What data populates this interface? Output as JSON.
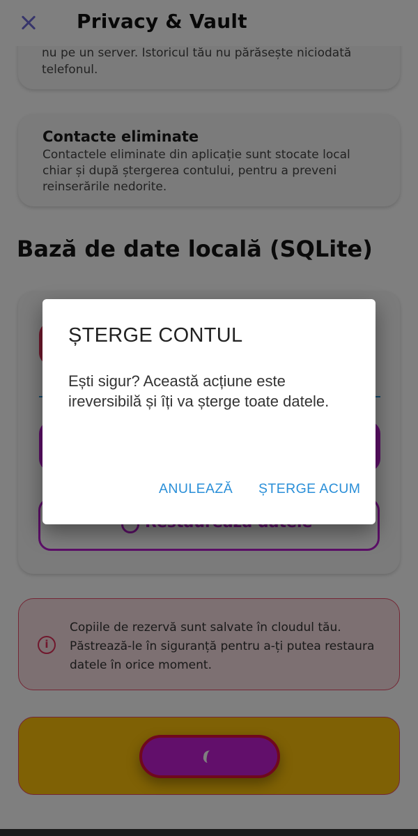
{
  "header": {
    "title": "Privacy & Vault",
    "close_icon": "close-icon"
  },
  "cards": {
    "history": {
      "text": "nu pe un server. Istoricul tău nu părăsește niciodată telefonul."
    },
    "deleted_contacts": {
      "title": "Contacte eliminate",
      "text": "Contactele eliminate din aplicație sunt stocate local chiar și după ștergerea contului, pentru a preveni reinserările nedorite."
    }
  },
  "sqlite_section": {
    "title": "Bază de date locală (SQLite)",
    "restore_label": "Restaurează datele",
    "restore_icon": "restore-icon"
  },
  "info": {
    "icon": "info-icon",
    "text": "Copiile de rezervă sunt salvate în cloudul tău. Păstrează-le în siguranță pentru a-ți putea restaura datele în orice moment."
  },
  "dialog": {
    "title": "ȘTERGE CONTUL",
    "body": "Ești sigur? Această acțiune este ireversibilă și îți va șterge toate datele.",
    "cancel_label": "ANULEAZĂ",
    "confirm_label": "ȘTERGE ACUM"
  },
  "colors": {
    "accent_blue": "#2a8fd8",
    "purple": "#b81fd0",
    "danger_red": "#e0305a",
    "warning_yellow": "#fec20a",
    "close_icon": "#6e6ad6"
  }
}
